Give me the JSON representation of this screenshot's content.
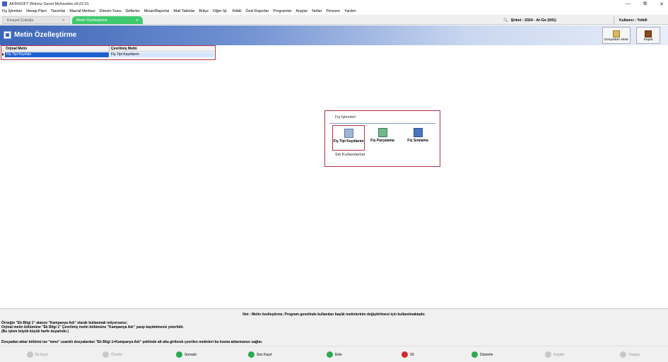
{
  "titlebar": {
    "title": "AKINSOFT Wolvox Genel Muhasebe s9.02.01",
    "minimize": "—",
    "restore": "⧉",
    "close": "✕"
  },
  "menu": [
    "Fiş İşlemleri",
    "Hesap Planı",
    "Tanımlar",
    "Masraf Merkezi",
    "Dönem Sonu",
    "Defterler",
    "Mizan/Raporlar",
    "Mali Tablolar",
    "Bütçe",
    "Diğer İşl.",
    "Yetkili",
    "Özel Raporlar",
    "Programlar",
    "Araçlar",
    "Notlar",
    "Pencere",
    "Yardım"
  ],
  "tabs": [
    {
      "label": "Kısayol Çubuğu",
      "close": "✕"
    },
    {
      "label": "Metin Özelleştirme",
      "close": "✕"
    }
  ],
  "status": {
    "sirket": "Şirket : 2024 - Ar-Ge (001)",
    "kullanici": "Kullanıcı : Yetkili",
    "search_glyph": "🔍"
  },
  "page": {
    "title": "Metin Özelleştirme",
    "btn_aktar": "Dosyadan Aktar",
    "btn_kapat": "Kapat"
  },
  "grid": {
    "col1": "Orjinal Metin",
    "col2": "Çevrilmiş Metin",
    "row1": {
      "orig": "Fiş Tipi Kayıtları",
      "translated": "Fiş Tipi Kayıtlarım"
    }
  },
  "panel": {
    "title": "Fiş İşlemleri",
    "tiles": [
      "Fiş Tipi Kayıtlarım",
      "Fiş Parçalama",
      "Fiş Sıralama"
    ],
    "sik": "Sık Kullanılanlar"
  },
  "notes": {
    "center": "Not : Metin özelleştirme; Program genelinde kullanılan başlık metinlerinin değiştirilmesi için kullanılmaktadır.",
    "l1": "Örneğin \"Ek Bilgi 1\" alanını \"Kampanya Adı\" olarak kullanmak istiyorsanız;",
    "l2": " Orjinal metin bölümüne \"Ek Bilgi 1\" Çevrilmiş metin bölümüne \"Kampanya Adı\" yazıp kaydetmeniz yeterlidir.",
    "l3": " (Bu işlem büyük küçük harfe duyarlıdır.)",
    "l4": "Dosyadan aktar bölümü ise \"wmo\" uzantılı dosyalardan \"Ek Bilgi 1=Kampanya Adı\" şeklinde alt alta girilerek çevrilen metinleri bu kısma aktarmanızı sağlar."
  },
  "nav": {
    "ilk": "İlk Kayıt",
    "onceki": "Önceki",
    "sonraki": "Sonraki",
    "son": "Son Kayıt",
    "ekle": "Ekle",
    "sil": "Sil",
    "duzenle": "Düzenle",
    "kaydet": "Kaydet",
    "vazgec": "Vazgeç"
  }
}
